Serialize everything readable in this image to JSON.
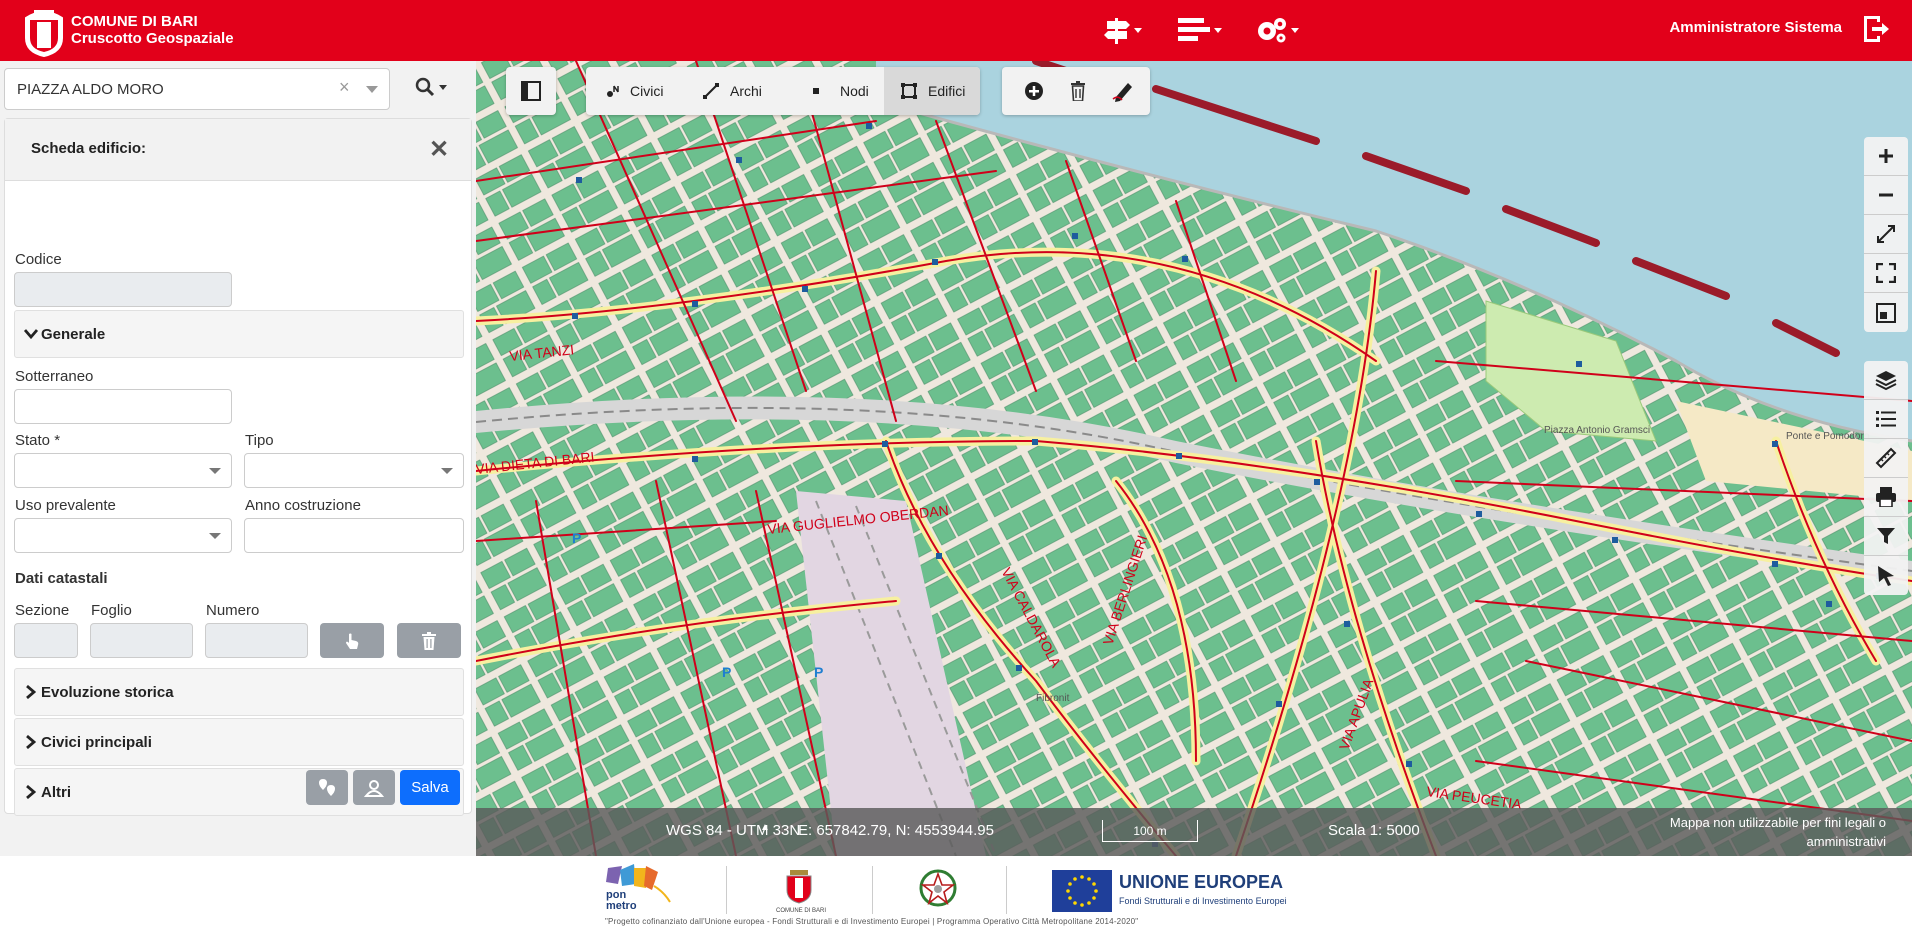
{
  "header": {
    "org_name": "COMUNE DI BARI",
    "app_name": "Cruscotto Geospaziale",
    "user": "Amministratore Sistema"
  },
  "search": {
    "value": "PIAZZA ALDO MORO"
  },
  "panel": {
    "title": "Scheda edificio:",
    "codice_label": "Codice",
    "generale_label": "Generale",
    "sotterraneo_label": "Sotterraneo",
    "stato_label": "Stato *",
    "tipo_label": "Tipo",
    "uso_label": "Uso prevalente",
    "anno_label": "Anno costruzione",
    "catastali_label": "Dati catastali",
    "sezione_label": "Sezione",
    "foglio_label": "Foglio",
    "numero_label": "Numero",
    "evoluzione_label": "Evoluzione storica",
    "civici_label": "Civici principali",
    "altri_label": "Altri",
    "save_label": "Salva"
  },
  "map_toolbar": {
    "civici": "Civici",
    "archi": "Archi",
    "nodi": "Nodi",
    "edifici": "Edifici"
  },
  "street_labels": [
    "VIA DIETA DI BARI",
    "VIA GUGLIELMO OBERDAN",
    "VIA CALDAROLA",
    "VIA BERLINGIERI",
    "VIA APULIA",
    "VIA PEUCETIA",
    "VIA TANZI",
    "Piazza Antonio Gramsci",
    "Ponte e Pomodoro",
    "Fibronit"
  ],
  "status": {
    "crs": "WGS 84 - UTM 33N",
    "coords": "E: 657842.79, N: 4553944.95",
    "scale_bar": "100 m",
    "scale": "Scala 1: 5000",
    "disclaimer": "Mappa non utilizzabile per fini legali o amministrativi"
  },
  "footer": {
    "pon_metro": "pon metro",
    "comune_caption": "COMUNE DI BARI",
    "eu_title": "UNIONE EUROPEA",
    "eu_subtitle": "Fondi Strutturali e di Investimento Europei",
    "caption": "\"Progetto cofinanziato dall'Unione europea - Fondi Strutturali e di Investimento Europei | Programma Operativo Città Metropolitane 2014-2020\""
  },
  "colors": {
    "brand_red": "#e2001a",
    "primary_blue": "#0d6efd",
    "building_green": "#6cbf8e",
    "sea": "#aad3df"
  }
}
